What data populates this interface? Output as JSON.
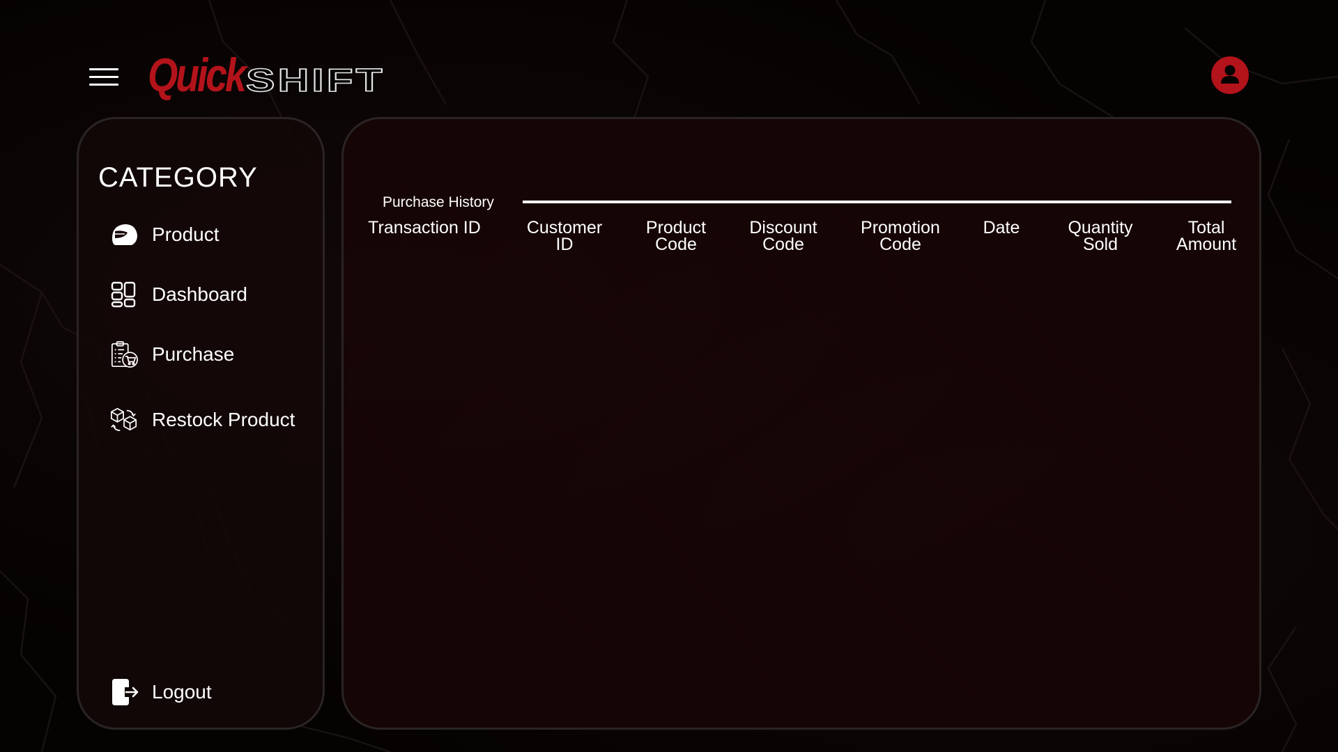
{
  "header": {
    "menu_icon": "hamburger-menu-icon",
    "logo": {
      "part1": "Quick",
      "part2": "SHIFT",
      "accent_color": "#b3131a"
    },
    "user_icon": "user-avatar-icon"
  },
  "sidebar": {
    "title": "CATEGORY",
    "items": [
      {
        "label": "Product",
        "icon": "helmet-icon"
      },
      {
        "label": "Dashboard",
        "icon": "dashboard-grid-icon"
      },
      {
        "label": "Purchase",
        "icon": "clipboard-cart-icon"
      },
      {
        "label": "Restock Product",
        "icon": "boxes-icon"
      }
    ],
    "logout": {
      "label": "Logout",
      "icon": "logout-door-icon"
    }
  },
  "main": {
    "section_title": "Purchase History",
    "table": {
      "columns": [
        "Transaction ID",
        "Customer\nID",
        "Product\nCode",
        "Discount\nCode",
        "Promotion\nCode",
        "Date",
        "Quantity\nSold",
        "Total\nAmount"
      ],
      "rows": []
    }
  },
  "theme": {
    "background": "#050202",
    "panel": "#180606",
    "accent": "#b3131a",
    "text": "#ffffff"
  }
}
